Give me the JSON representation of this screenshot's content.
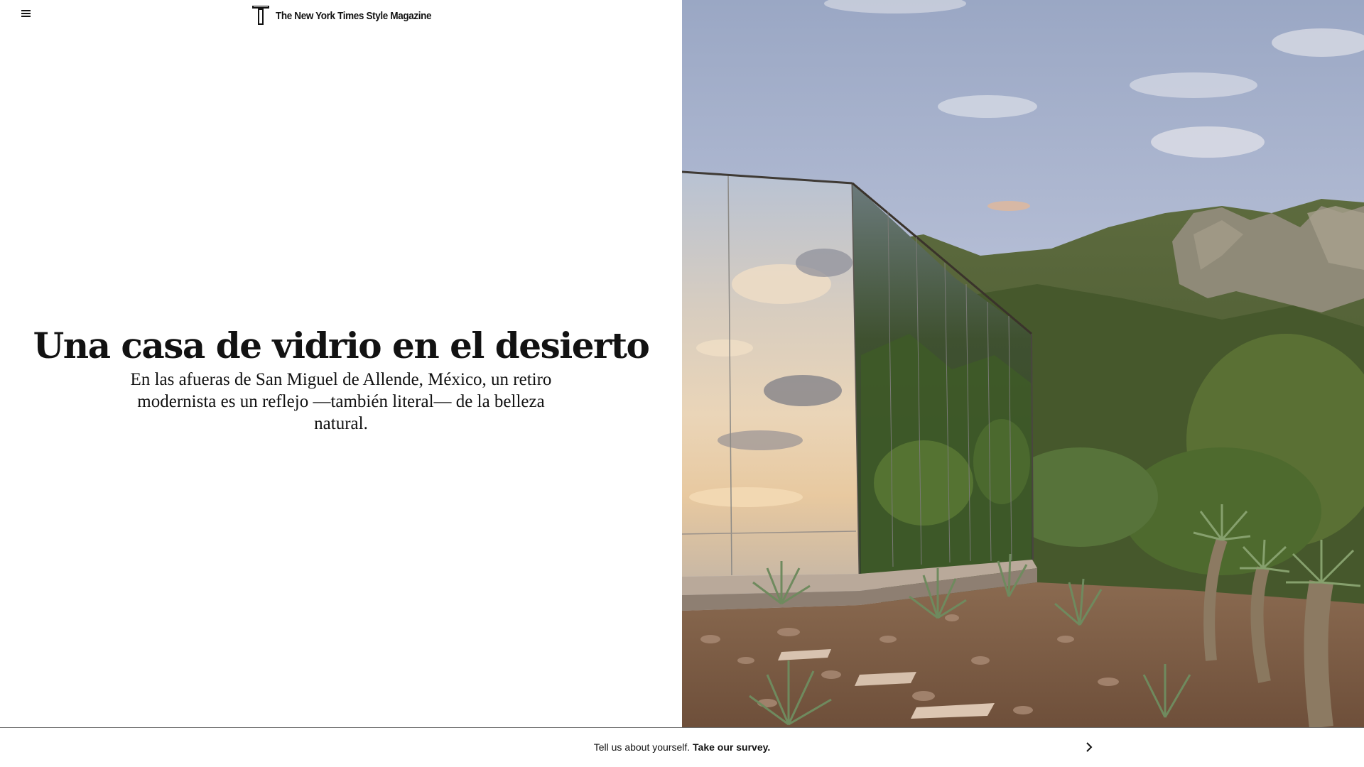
{
  "header": {
    "menu_icon": "hamburger-menu-icon",
    "logo_icon": "t-magazine-logo-icon",
    "logo_text": "The New York Times Style Magazine"
  },
  "article": {
    "headline": "Una casa de vidrio en el desierto",
    "dek": "En las afueras de San Miguel de Allende, México, un retiro modernista es un reflejo —también literal— de la belleza natural."
  },
  "survey": {
    "prompt": "Tell us about yourself.",
    "link_label": "Take our survey.",
    "chevron_icon": "chevron-right-icon"
  },
  "colors": {
    "text": "#121212",
    "background": "#ffffff",
    "divider": "#6b6b6b"
  }
}
